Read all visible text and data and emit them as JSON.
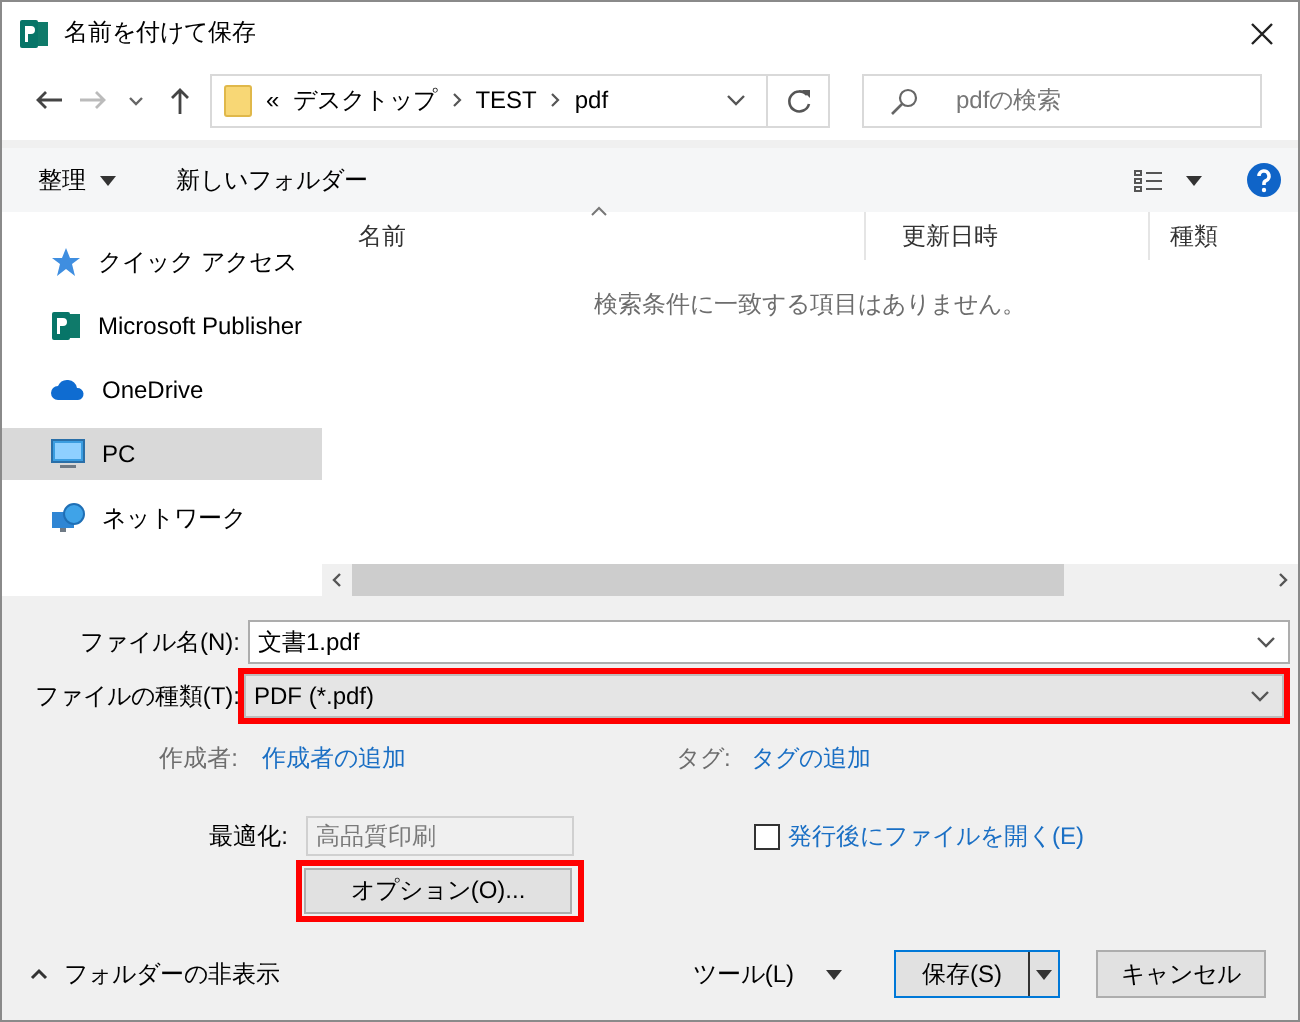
{
  "window": {
    "title": "名前を付けて保存"
  },
  "address": {
    "overflow": "«",
    "crumbs": [
      "デスクトップ",
      "TEST",
      "pdf"
    ]
  },
  "search": {
    "placeholder": "pdfの検索"
  },
  "toolbar": {
    "organize": "整理",
    "new_folder": "新しいフォルダー"
  },
  "sidebar": {
    "items": [
      {
        "label": "クイック アクセス",
        "kind": "star",
        "selected": false
      },
      {
        "label": "Microsoft Publisher",
        "kind": "publisher",
        "selected": false
      },
      {
        "label": "OneDrive",
        "kind": "cloud",
        "selected": false
      },
      {
        "label": "PC",
        "kind": "pc",
        "selected": true
      },
      {
        "label": "ネットワーク",
        "kind": "network",
        "selected": false
      }
    ]
  },
  "table": {
    "columns": [
      "名前",
      "更新日時",
      "種類"
    ],
    "empty_message": "検索条件に一致する項目はありません。"
  },
  "form": {
    "file_name": {
      "label": "ファイル名(N):",
      "value": "文書1.pdf"
    },
    "file_type": {
      "label": "ファイルの種類(T):",
      "value": "PDF (*.pdf)",
      "highlighted": true
    },
    "author": {
      "label": "作成者:",
      "link": "作成者の追加"
    },
    "tags": {
      "label": "タグ:",
      "link": "タグの追加"
    },
    "optimize": {
      "label": "最適化:",
      "value": "高品質印刷"
    },
    "open_after": {
      "label": "発行後にファイルを開く(E)",
      "checked": false
    },
    "options_button": {
      "label": "オプション(O)...",
      "highlighted": true
    }
  },
  "footer": {
    "hide_folders": "フォルダーの非表示",
    "tools": "ツール(L)",
    "save": "保存(S)",
    "cancel": "キャンセル"
  }
}
